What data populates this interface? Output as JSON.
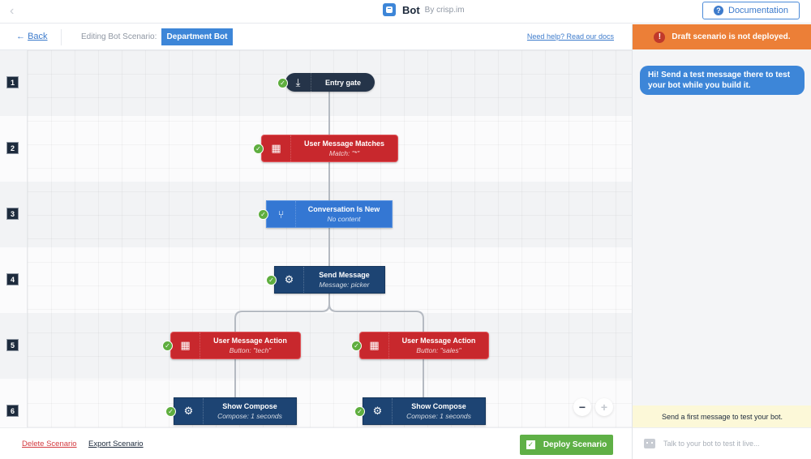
{
  "topbar": {
    "app_name": "Bot",
    "app_by": "By crisp.im",
    "back_glyph": "‹",
    "documentation_label": "Documentation",
    "documentation_icon": "?"
  },
  "subbar": {
    "back_label": "Back",
    "back_arrow": "←",
    "editing_label": "Editing Bot Scenario:",
    "scenario_name": "Department Bot",
    "help_link": "Need help? Read our docs"
  },
  "rows": [
    "1",
    "2",
    "3",
    "4",
    "5",
    "6"
  ],
  "nodes": [
    {
      "id": "entry",
      "title": "Entry gate",
      "subtitle": "",
      "type": "entry",
      "icon": "download-icon",
      "glyph": "⤓"
    },
    {
      "id": "match",
      "title": "User Message Matches",
      "subtitle": "Match: \"*\"",
      "type": "red",
      "icon": "calendar-icon",
      "glyph": "▦"
    },
    {
      "id": "new",
      "title": "Conversation Is New",
      "subtitle": "No content",
      "type": "blue",
      "icon": "branch-icon",
      "glyph": "⑂"
    },
    {
      "id": "send",
      "title": "Send Message",
      "subtitle": "Message: picker",
      "type": "navy",
      "icon": "gears-icon",
      "glyph": "⚙"
    },
    {
      "id": "action-tech",
      "title": "User Message Action",
      "subtitle": "Button: \"tech\"",
      "type": "red",
      "icon": "calendar-icon",
      "glyph": "▦"
    },
    {
      "id": "action-sales",
      "title": "User Message Action",
      "subtitle": "Button: \"sales\"",
      "type": "red",
      "icon": "calendar-icon",
      "glyph": "▦"
    },
    {
      "id": "compose-tech",
      "title": "Show Compose",
      "subtitle": "Compose: 1 seconds",
      "type": "navy",
      "icon": "gears-icon",
      "glyph": "⚙"
    },
    {
      "id": "compose-sales",
      "title": "Show Compose",
      "subtitle": "Compose: 1 seconds",
      "type": "navy",
      "icon": "gears-icon",
      "glyph": "⚙"
    }
  ],
  "check_glyph": "✓",
  "zoom": {
    "out": "−",
    "in": "+"
  },
  "footer": {
    "delete_label": "Delete Scenario",
    "export_label": "Export Scenario",
    "deploy_label": "Deploy Scenario",
    "deploy_glyph": "✓"
  },
  "panel": {
    "draft_banner": "Draft scenario is not deployed.",
    "draft_icon": "!",
    "bot_message": "Hi! Send a test message there to test your bot while you build it.",
    "hint": "Send a first message to test your bot.",
    "input_placeholder": "Talk to your bot to test it live..."
  },
  "colors": {
    "accent_blue": "#3d86d8",
    "draft_orange": "#ec7f37",
    "deploy_green": "#5fb046",
    "node_red": "#c8282d",
    "node_navy": "#1d4473",
    "node_entry": "#253449",
    "node_blue": "#3477d3"
  }
}
